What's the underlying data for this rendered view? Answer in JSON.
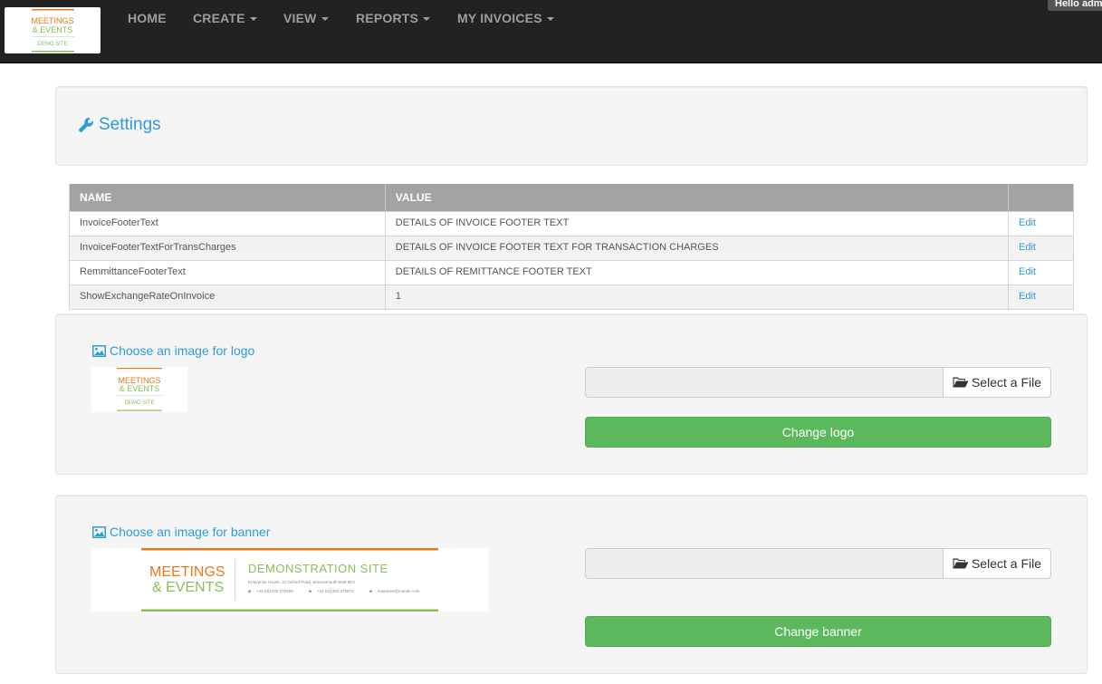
{
  "brand": {
    "line1": "MEETINGS",
    "line2": "& EVENTS",
    "line3": "DEMO SITE",
    "color_orange": "#e9781c",
    "color_green": "#8bbd5a"
  },
  "nav": {
    "items": [
      {
        "label": "HOME",
        "dropdown": false
      },
      {
        "label": "CREATE",
        "dropdown": true
      },
      {
        "label": "VIEW",
        "dropdown": true
      },
      {
        "label": "REPORTS",
        "dropdown": true
      },
      {
        "label": "MY INVOICES",
        "dropdown": true
      }
    ],
    "greeting": "Hello admi"
  },
  "settings": {
    "title": "Settings",
    "icon": "wrench-icon"
  },
  "table": {
    "headers": [
      "NAME",
      "VALUE",
      ""
    ],
    "rows": [
      {
        "name": "InvoiceFooterText",
        "value": "DETAILS OF INVOICE FOOTER TEXT",
        "action": "Edit"
      },
      {
        "name": "InvoiceFooterTextForTransCharges",
        "value": "DETAILS OF INVOICE FOOTER TEXT FOR TRANSACTION CHARGES",
        "action": "Edit"
      },
      {
        "name": "RemmittanceFooterText",
        "value": "DETAILS OF REMITTANCE FOOTER TEXT",
        "action": "Edit"
      },
      {
        "name": "ShowExchangeRateOnInvoice",
        "value": "1",
        "action": "Edit"
      }
    ]
  },
  "logo_section": {
    "choose_label": "Choose an image for logo",
    "select_label": "Select a File",
    "button_label": "Change logo"
  },
  "banner_section": {
    "choose_label": "Choose an image for banner",
    "select_label": "Select a File",
    "button_label": "Change banner",
    "banner_title": "DEMONSTRATION SITE",
    "banner_address": "Enterprise House, 21 Oxford Road, Bournemouth BH8 8EY",
    "banner_phone1": "+44 (0)1202 375550",
    "banner_phone2": "+44 (0)1202 375574",
    "banner_email": "enquiries@mande.com"
  },
  "colors": {
    "link": "#2d9dd6",
    "success": "#5cb85c",
    "navbar": "#222222"
  }
}
